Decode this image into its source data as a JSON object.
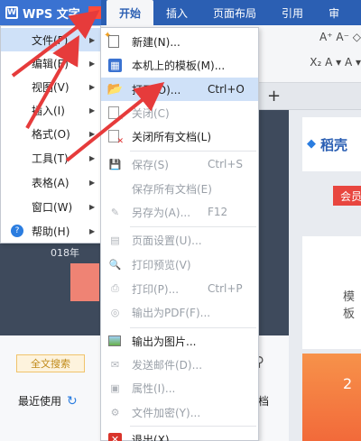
{
  "app": {
    "title": "WPS 文字",
    "logo_icon": "W",
    "dropdown_icon": "▾"
  },
  "ribbon": {
    "tabs": [
      {
        "label": "开始",
        "active": true
      },
      {
        "label": "插入",
        "active": false
      },
      {
        "label": "页面布局",
        "active": false
      },
      {
        "label": "引用",
        "active": false
      },
      {
        "label": "审",
        "active": false
      }
    ],
    "toolbar_row1": "A⁺ A⁻ ◇",
    "toolbar_row2": "X₂ A ▾ A ▾"
  },
  "doc_strip": {
    "new_tab_icon": "+"
  },
  "main_menu": {
    "items": [
      {
        "label": "文件(F)",
        "has_sub": true,
        "active": true
      },
      {
        "label": "编辑(E)",
        "has_sub": true,
        "active": false
      },
      {
        "label": "视图(V)",
        "has_sub": true,
        "active": false
      },
      {
        "label": "插入(I)",
        "has_sub": true,
        "active": false
      },
      {
        "label": "格式(O)",
        "has_sub": true,
        "active": false
      },
      {
        "label": "工具(T)",
        "has_sub": true,
        "active": false
      },
      {
        "label": "表格(A)",
        "has_sub": true,
        "active": false
      },
      {
        "label": "窗口(W)",
        "has_sub": true,
        "active": false
      },
      {
        "label": "帮助(H)",
        "has_sub": true,
        "active": false,
        "icon": "?"
      }
    ]
  },
  "file_submenu": {
    "items": [
      {
        "label": "新建(N)...",
        "shortcut": "",
        "icon": "new-doc-icon",
        "disabled": false,
        "hover": false
      },
      {
        "label": "本机上的模板(M)...",
        "shortcut": "",
        "icon": "template-icon",
        "disabled": false,
        "hover": false
      },
      {
        "label": "打开(O)...",
        "shortcut": "Ctrl+O",
        "icon": "open-folder-icon",
        "disabled": false,
        "hover": true
      },
      {
        "label": "关闭(C)",
        "shortcut": "",
        "icon": "close-doc-icon",
        "disabled": true,
        "hover": false
      },
      {
        "label": "关闭所有文档(L)",
        "shortcut": "",
        "icon": "close-all-icon",
        "disabled": false,
        "hover": false
      },
      {
        "label": "保存(S)",
        "shortcut": "Ctrl+S",
        "icon": "save-icon",
        "disabled": true,
        "hover": false
      },
      {
        "label": "保存所有文档(E)",
        "shortcut": "",
        "icon": "",
        "disabled": true,
        "hover": false
      },
      {
        "label": "另存为(A)...",
        "shortcut": "F12",
        "icon": "save-as-icon",
        "disabled": true,
        "hover": false
      },
      {
        "label": "页面设置(U)...",
        "shortcut": "",
        "icon": "page-setup-icon",
        "disabled": true,
        "hover": false
      },
      {
        "label": "打印预览(V)",
        "shortcut": "",
        "icon": "print-preview-icon",
        "disabled": true,
        "hover": false
      },
      {
        "label": "打印(P)...",
        "shortcut": "Ctrl+P",
        "icon": "print-icon",
        "disabled": true,
        "hover": false
      },
      {
        "label": "输出为PDF(F)...",
        "shortcut": "",
        "icon": "pdf-icon",
        "disabled": true,
        "hover": false
      },
      {
        "label": "输出为图片...",
        "shortcut": "",
        "icon": "image-export-icon",
        "disabled": false,
        "hover": false
      },
      {
        "label": "发送邮件(D)...",
        "shortcut": "",
        "icon": "mail-icon",
        "disabled": true,
        "hover": false
      },
      {
        "label": "属性(I)...",
        "shortcut": "",
        "icon": "properties-icon",
        "disabled": true,
        "hover": false
      },
      {
        "label": "文件加密(Y)...",
        "shortcut": "",
        "icon": "encrypt-icon",
        "disabled": true,
        "hover": false
      },
      {
        "label": "退出(X)",
        "shortcut": "",
        "icon": "exit-icon",
        "disabled": false,
        "hover": false
      }
    ]
  },
  "background": {
    "date_text": "018年",
    "search_tag": "全文搜索",
    "search_extra": "搜",
    "recent_label": "最近使用",
    "doc_word": "档",
    "brand_text": "稻壳",
    "vip_label": "会员",
    "template_text": "模板",
    "orange_number": "2"
  },
  "colors": {
    "ribbon_blue": "#2b5fb3",
    "wps_button": "#3a72d1",
    "hover_row": "#cfe1f8",
    "disabled_text": "#9aa0a8",
    "annotation_arrow": "#e63b3b"
  }
}
